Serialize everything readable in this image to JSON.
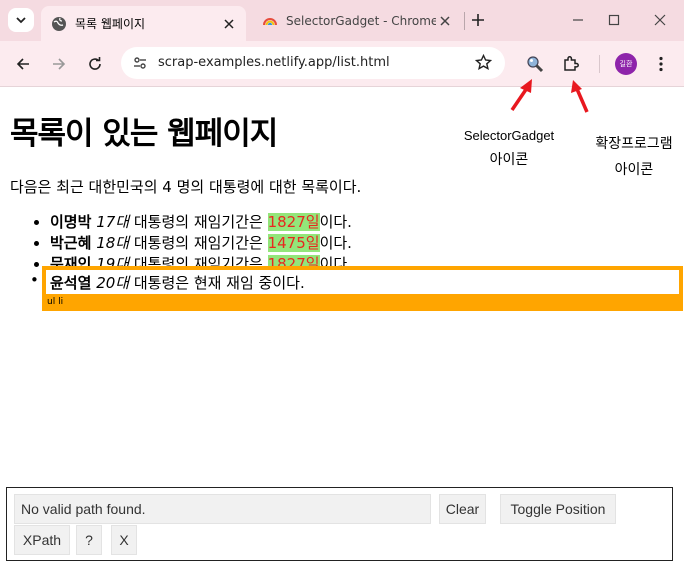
{
  "browser": {
    "tabs": [
      {
        "title": "목록 웹페이지",
        "active": true
      },
      {
        "title": "SelectorGadget - Chrome",
        "active": false
      }
    ],
    "url": "scrap-examples.netlify.app/list.html",
    "profile_label": "길환"
  },
  "page": {
    "title": "목록이 있는 웹페이지",
    "intro": "다음은 최근 대한민국의 4 명의 대통령에 대한 목록이다.",
    "presidents": [
      {
        "name": "이명박",
        "order": "17대",
        "mid": " 대통령의 재임기간은 ",
        "days": "1827일",
        "end": "이다."
      },
      {
        "name": "박근혜",
        "order": "18대",
        "mid": " 대통령의 재임기간은 ",
        "days": "1475일",
        "end": "이다."
      },
      {
        "name": "문재인",
        "order": "19대",
        "mid": " 대통령의 재임기간은 ",
        "days": "1827일",
        "end": "이다."
      }
    ],
    "current": {
      "name": "윤석열",
      "order": "20대",
      "rest": " 대통령은 현재 재임 중이다."
    },
    "selector_tag": "ul li"
  },
  "annotations": {
    "sg_line1": "SelectorGadget",
    "sg_line2": "아이콘",
    "ext_line1": "확장프로그램",
    "ext_line2": "아이콘"
  },
  "selectorgadget": {
    "path_text": "No valid path found.",
    "clear": "Clear",
    "toggle_position": "Toggle Position",
    "xpath": "XPath",
    "help": "?",
    "close": "X"
  },
  "colors": {
    "highlight_border": "#ffa500",
    "selected_bg": "#93e57a",
    "selected_text": "#e8281f",
    "arrow": "#e8181f"
  }
}
